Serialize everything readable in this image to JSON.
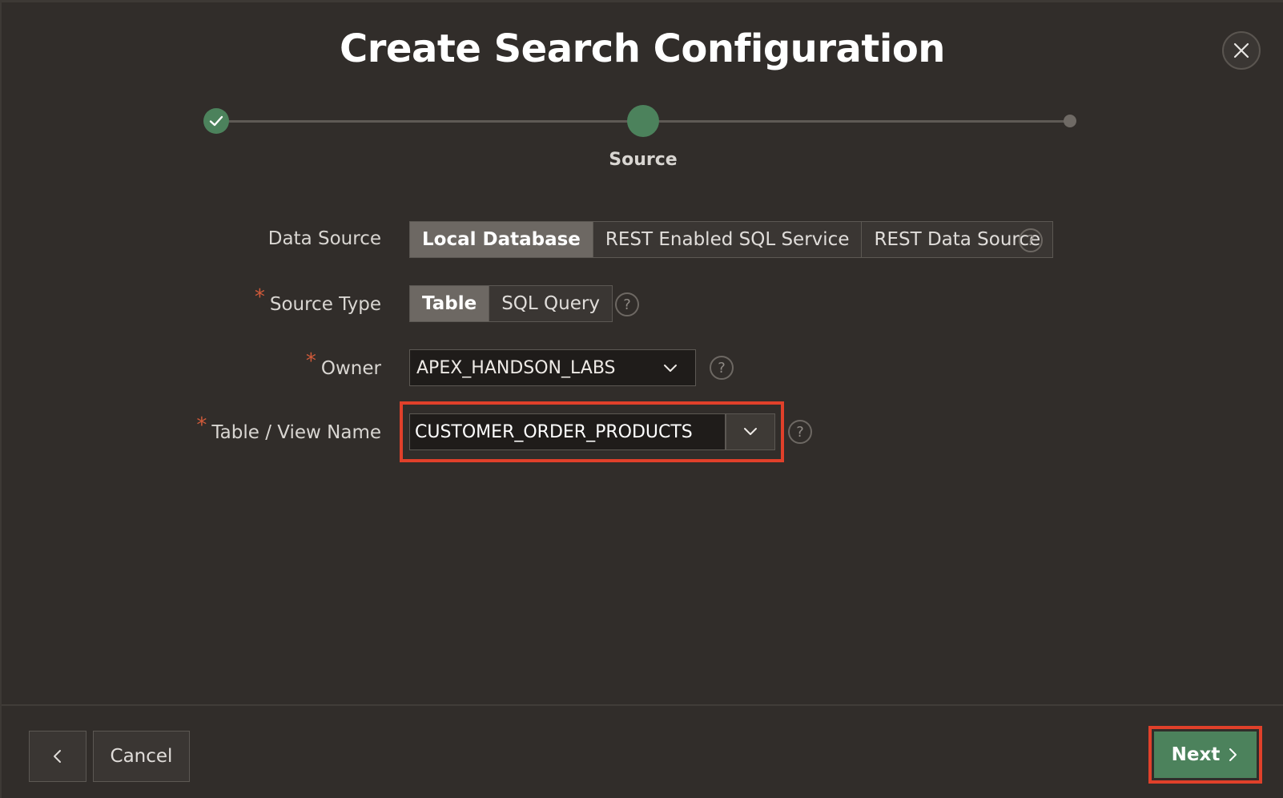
{
  "dialog": {
    "title": "Create Search Configuration",
    "close_icon": "close-icon"
  },
  "wizard": {
    "steps": [
      {
        "state": "complete"
      },
      {
        "state": "current",
        "label": "Source"
      },
      {
        "state": "future"
      }
    ]
  },
  "form": {
    "data_source": {
      "label": "Data Source",
      "options": [
        "Local Database",
        "REST Enabled SQL Service",
        "REST Data Source"
      ],
      "selected": "Local Database"
    },
    "source_type": {
      "required_mark": "*",
      "label": "Source Type",
      "options": [
        "Table",
        "SQL Query"
      ],
      "selected": "Table"
    },
    "owner": {
      "required_mark": "*",
      "label": "Owner",
      "value": "APEX_HANDSON_LABS"
    },
    "table_view_name": {
      "required_mark": "*",
      "label": "Table / View Name",
      "value": "CUSTOMER_ORDER_PRODUCTS"
    },
    "help_glyph": "?"
  },
  "footer": {
    "cancel_label": "Cancel",
    "next_label": "Next"
  },
  "colors": {
    "accent_green": "#4c825c",
    "highlight_red": "#e0402a",
    "background": "#312d2a"
  }
}
